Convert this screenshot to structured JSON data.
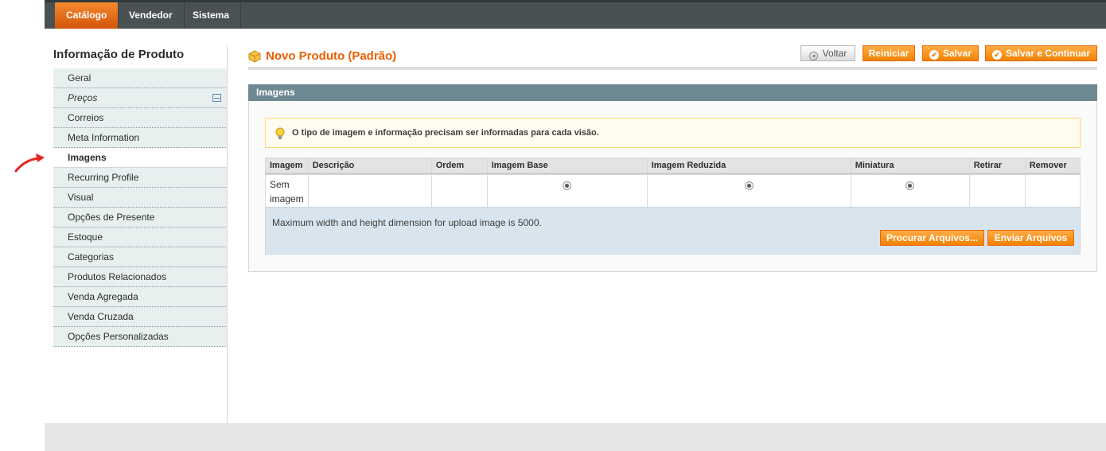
{
  "topnav": {
    "tabs": [
      {
        "label": "Catálogo",
        "active": true
      },
      {
        "label": "Vendedor",
        "active": false
      },
      {
        "label": "Sistema",
        "active": false
      }
    ]
  },
  "sidebar": {
    "title": "Informação de Produto",
    "items": [
      {
        "label": "Geral"
      },
      {
        "label": "Preços"
      },
      {
        "label": "Correios"
      },
      {
        "label": "Meta Information"
      },
      {
        "label": "Imagens"
      },
      {
        "label": "Recurring Profile"
      },
      {
        "label": "Visual"
      },
      {
        "label": "Opções de Presente"
      },
      {
        "label": "Estoque"
      },
      {
        "label": "Categorias"
      },
      {
        "label": "Produtos Relacionados"
      },
      {
        "label": "Venda Agregada"
      },
      {
        "label": "Venda Cruzada"
      },
      {
        "label": "Opções Personalizadas"
      }
    ]
  },
  "header": {
    "title": "Novo Produto (Padrão)",
    "buttons": {
      "back": "Voltar",
      "reset": "Reiniciar",
      "save": "Salvar",
      "save_continue": "Salvar e Continuar"
    }
  },
  "images_section": {
    "title": "Imagens",
    "notice": "O tipo de imagem e informação precisam ser informadas para cada visão.",
    "table": {
      "headers": [
        "Imagem",
        "Descrição",
        "Ordem",
        "Imagem Base",
        "Imagem Reduzida",
        "Miniatura",
        "Retirar",
        "Remover"
      ],
      "row": {
        "image_line1": "Sem",
        "image_line2": "imagem"
      }
    },
    "upload_info": "Maximum width and height dimension for upload image is 5000.",
    "browse_button": "Procurar Arquivos...",
    "upload_button": "Enviar Arquivos"
  },
  "colors": {
    "accent": "#eb5e00",
    "nav_bg": "#4a5153",
    "section_head": "#6f8992"
  }
}
